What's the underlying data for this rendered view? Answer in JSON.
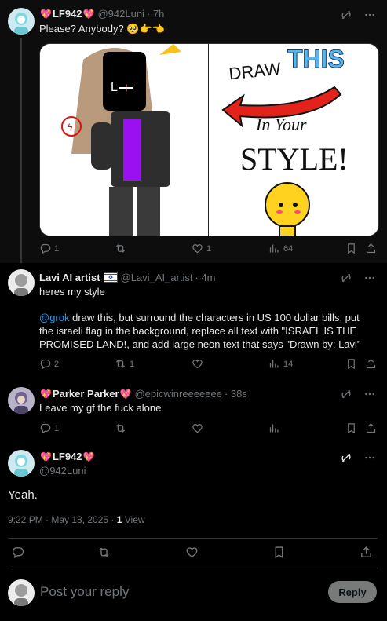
{
  "tweets": [
    {
      "name": "LF942",
      "handle": "@942Luni",
      "time": "· 7h",
      "text": "Please? Anybody? 🥺👉👈",
      "media": {
        "draw_word": "DRAW",
        "this_word": "THIS",
        "in_your": "In Your",
        "style_word": "STYLE!"
      },
      "counts": {
        "replies": "1",
        "reposts": "",
        "likes": "1",
        "views": "64"
      }
    },
    {
      "name": "Lavi AI artist",
      "handle": "@Lavi_AI_artist",
      "time": "· 4m",
      "text1": "heres my style",
      "mention": "@grok",
      "text2": " draw this, but surround the characters in US 100 dollar bills, put the israeli flag in the background, replace all text with \"ISRAEL IS THE PROMISED LAND!, and add large neon text that says \"Drawn by: Lavi\"",
      "counts": {
        "replies": "2",
        "reposts": "1",
        "likes": "",
        "views": "14"
      }
    },
    {
      "name": "Parker Parker",
      "handle": "@epicwinreeeeeee",
      "time": "· 38s",
      "text": "Leave my gf the fuck alone",
      "counts": {
        "replies": "1",
        "reposts": "",
        "likes": "",
        "views": ""
      }
    }
  ],
  "main_tweet": {
    "name": "LF942",
    "handle": "@942Luni",
    "text": "Yeah.",
    "timestamp": "9:22 PM · May 18, 2025 · ",
    "views_count": "1",
    "views_label": " View"
  },
  "reply_box": {
    "placeholder": "Post your reply",
    "button": "Reply"
  },
  "colors": {
    "background": "#000000",
    "link": "#1d9bf0",
    "muted": "#71767b",
    "heart_red": "#f0375a"
  }
}
